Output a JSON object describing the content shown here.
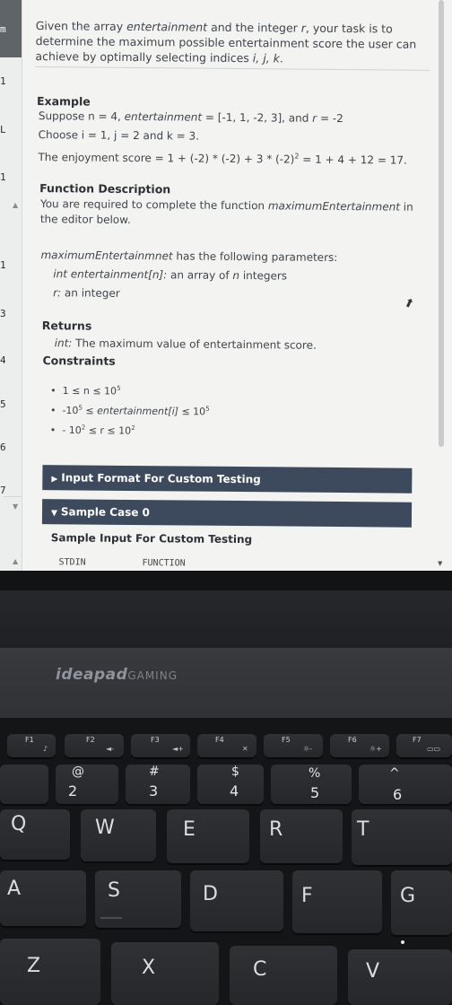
{
  "gutter": {
    "line_labels": [
      "m",
      "1",
      "L",
      "1",
      "",
      "1",
      "3",
      "4",
      "5",
      "6",
      "7"
    ]
  },
  "problem": {
    "intro_parts": [
      "Given the array ",
      "entertainment",
      " and the integer ",
      "r",
      ", your task is to determine the maximum possible entertainment score the user can achieve by optimally selecting indices ",
      "i, j, k",
      "."
    ],
    "example": {
      "heading": "Example",
      "line1_parts": [
        "Suppose n = 4, ",
        "entertainment",
        " = [-1, 1, -2, 3], and ",
        "r",
        " = -2"
      ],
      "line2": "Choose i = 1, j = 2 and k = 3.",
      "line3_pre": "The enjoyment score = 1 + (-2) * (-2) + 3 * (-2)",
      "line3_sup": "2",
      "line3_post": " = 1 + 4 + 12 = 17."
    },
    "function_description": {
      "heading": "Function Description",
      "text_pre": "You are required to complete the function ",
      "function_name": "maximumEntertainment",
      "text_post": " in the editor below.",
      "params_intro_name": "maximumEntertainmnet",
      "params_intro_rest": " has the following parameters:",
      "param1": "int entertainment[n]:",
      "param1_rest": " an array of ",
      "param1_n": "n",
      "param1_end": " integers",
      "param2": "r:",
      "param2_rest": " an integer"
    },
    "returns": {
      "heading": "Returns",
      "type": "int:",
      "text": " The maximum value of entertainment score."
    },
    "constraints": {
      "heading": "Constraints",
      "items": [
        {
          "pre": "1 ≤ n ≤ 10",
          "sup": "5",
          "mid": "",
          "sup2": "",
          "post": ""
        },
        {
          "pre": "-10",
          "sup": "5",
          "mid": " ≤ ",
          "italic": "entertainment[i]",
          "mid2": " ≤ 10",
          "sup2": "5",
          "post": ""
        },
        {
          "pre": "- 10",
          "sup": "2",
          "mid": " ≤ r ≤ 10",
          "sup2": "2",
          "post": ""
        }
      ]
    },
    "input_format_label": "Input Format For Custom Testing",
    "sample_case_label": "Sample Case 0",
    "sample_input_label": "Sample Input For Custom Testing",
    "stdin_label": "STDIN",
    "function_label": "FUNCTION"
  },
  "laptop": {
    "brand": "ideapad",
    "brand_sub": "GAMING",
    "fn_keys": [
      "F1",
      "F2",
      "F3",
      "F4",
      "F5",
      "F6",
      "F7"
    ],
    "number_keys": [
      {
        "sym": "@",
        "num": "2"
      },
      {
        "sym": "#",
        "num": "3"
      },
      {
        "sym": "$",
        "num": "4"
      },
      {
        "sym": "%",
        "num": "5"
      },
      {
        "sym": "^",
        "num": "6"
      }
    ],
    "row_q": [
      "Q",
      "W",
      "E",
      "R",
      "T"
    ],
    "row_a": [
      "A",
      "S",
      "D",
      "F",
      "G"
    ],
    "row_z": [
      "Z",
      "X",
      "C",
      "V"
    ]
  },
  "colors": {
    "section_bar": "#3d4a5d",
    "screen_bg": "#f3f4f2",
    "keyboard": "#141517"
  }
}
